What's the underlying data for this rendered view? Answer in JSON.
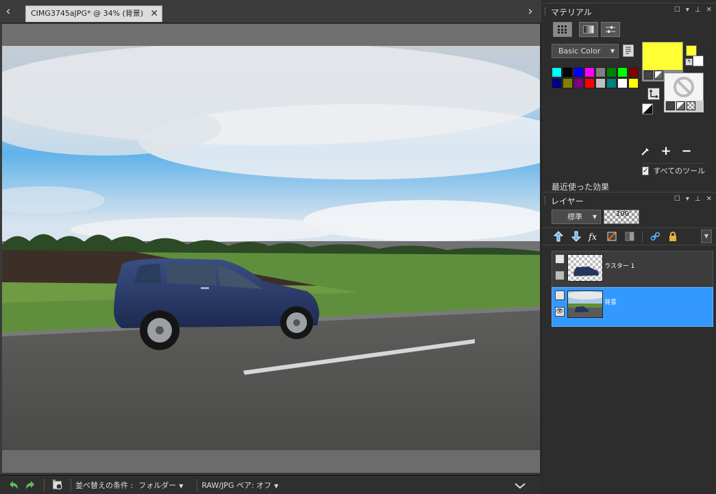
{
  "document": {
    "tab_title": "CIMG3745aJPG* @  34% (背景)"
  },
  "bottom_bar": {
    "sort_label": "並べ替えの条件 :",
    "sort_value": "フォルダー",
    "pair_label": "RAW/JPG ペア: オフ"
  },
  "materials": {
    "title": "マテリアル",
    "palette_name": "Basic Color",
    "swatches": [
      "#00ffff",
      "#000000",
      "#0000ff",
      "#ff00ff",
      "#808080",
      "#008000",
      "#00ff00",
      "#800000",
      "#000080",
      "#808000",
      "#800080",
      "#ff0000",
      "#c0c0c0",
      "#008080",
      "#ffffff",
      "#ffff00"
    ],
    "foreground_color": "#ffff33",
    "all_tools_label": "すべてのツール",
    "recent_effects_label": "最近使った効果"
  },
  "layers": {
    "title": "レイヤー",
    "blend_mode": "標準",
    "opacity": "100",
    "items": [
      {
        "name": "ラスター 1",
        "selected": false
      },
      {
        "name": "背景",
        "selected": true
      }
    ]
  },
  "colors": {
    "accent": "#3399ff",
    "panel_bg": "#2d2d2d"
  }
}
